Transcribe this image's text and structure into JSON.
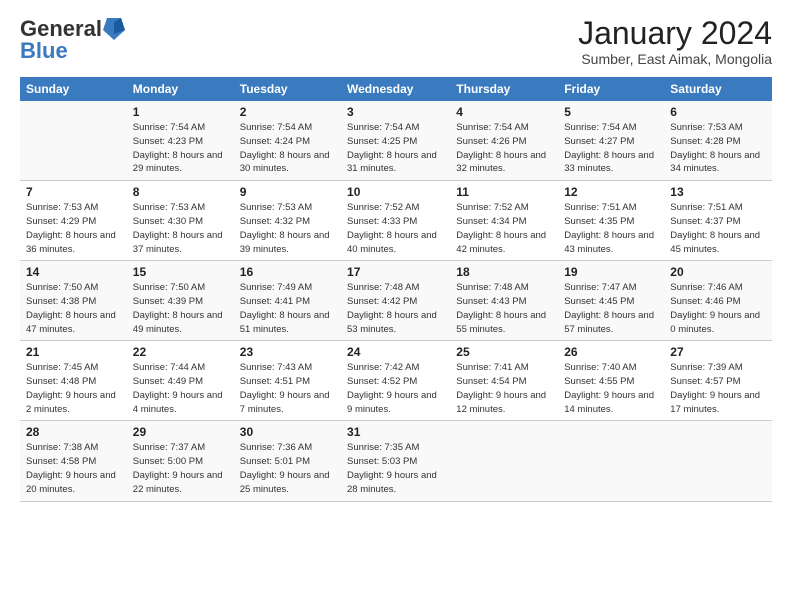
{
  "logo": {
    "general": "General",
    "blue": "Blue"
  },
  "header": {
    "title": "January 2024",
    "subtitle": "Sumber, East Aimak, Mongolia"
  },
  "weekdays": [
    "Sunday",
    "Monday",
    "Tuesday",
    "Wednesday",
    "Thursday",
    "Friday",
    "Saturday"
  ],
  "weeks": [
    [
      {
        "day": "",
        "sunrise": "",
        "sunset": "",
        "daylight": ""
      },
      {
        "day": "1",
        "sunrise": "Sunrise: 7:54 AM",
        "sunset": "Sunset: 4:23 PM",
        "daylight": "Daylight: 8 hours and 29 minutes."
      },
      {
        "day": "2",
        "sunrise": "Sunrise: 7:54 AM",
        "sunset": "Sunset: 4:24 PM",
        "daylight": "Daylight: 8 hours and 30 minutes."
      },
      {
        "day": "3",
        "sunrise": "Sunrise: 7:54 AM",
        "sunset": "Sunset: 4:25 PM",
        "daylight": "Daylight: 8 hours and 31 minutes."
      },
      {
        "day": "4",
        "sunrise": "Sunrise: 7:54 AM",
        "sunset": "Sunset: 4:26 PM",
        "daylight": "Daylight: 8 hours and 32 minutes."
      },
      {
        "day": "5",
        "sunrise": "Sunrise: 7:54 AM",
        "sunset": "Sunset: 4:27 PM",
        "daylight": "Daylight: 8 hours and 33 minutes."
      },
      {
        "day": "6",
        "sunrise": "Sunrise: 7:53 AM",
        "sunset": "Sunset: 4:28 PM",
        "daylight": "Daylight: 8 hours and 34 minutes."
      }
    ],
    [
      {
        "day": "7",
        "sunrise": "Sunrise: 7:53 AM",
        "sunset": "Sunset: 4:29 PM",
        "daylight": "Daylight: 8 hours and 36 minutes."
      },
      {
        "day": "8",
        "sunrise": "Sunrise: 7:53 AM",
        "sunset": "Sunset: 4:30 PM",
        "daylight": "Daylight: 8 hours and 37 minutes."
      },
      {
        "day": "9",
        "sunrise": "Sunrise: 7:53 AM",
        "sunset": "Sunset: 4:32 PM",
        "daylight": "Daylight: 8 hours and 39 minutes."
      },
      {
        "day": "10",
        "sunrise": "Sunrise: 7:52 AM",
        "sunset": "Sunset: 4:33 PM",
        "daylight": "Daylight: 8 hours and 40 minutes."
      },
      {
        "day": "11",
        "sunrise": "Sunrise: 7:52 AM",
        "sunset": "Sunset: 4:34 PM",
        "daylight": "Daylight: 8 hours and 42 minutes."
      },
      {
        "day": "12",
        "sunrise": "Sunrise: 7:51 AM",
        "sunset": "Sunset: 4:35 PM",
        "daylight": "Daylight: 8 hours and 43 minutes."
      },
      {
        "day": "13",
        "sunrise": "Sunrise: 7:51 AM",
        "sunset": "Sunset: 4:37 PM",
        "daylight": "Daylight: 8 hours and 45 minutes."
      }
    ],
    [
      {
        "day": "14",
        "sunrise": "Sunrise: 7:50 AM",
        "sunset": "Sunset: 4:38 PM",
        "daylight": "Daylight: 8 hours and 47 minutes."
      },
      {
        "day": "15",
        "sunrise": "Sunrise: 7:50 AM",
        "sunset": "Sunset: 4:39 PM",
        "daylight": "Daylight: 8 hours and 49 minutes."
      },
      {
        "day": "16",
        "sunrise": "Sunrise: 7:49 AM",
        "sunset": "Sunset: 4:41 PM",
        "daylight": "Daylight: 8 hours and 51 minutes."
      },
      {
        "day": "17",
        "sunrise": "Sunrise: 7:48 AM",
        "sunset": "Sunset: 4:42 PM",
        "daylight": "Daylight: 8 hours and 53 minutes."
      },
      {
        "day": "18",
        "sunrise": "Sunrise: 7:48 AM",
        "sunset": "Sunset: 4:43 PM",
        "daylight": "Daylight: 8 hours and 55 minutes."
      },
      {
        "day": "19",
        "sunrise": "Sunrise: 7:47 AM",
        "sunset": "Sunset: 4:45 PM",
        "daylight": "Daylight: 8 hours and 57 minutes."
      },
      {
        "day": "20",
        "sunrise": "Sunrise: 7:46 AM",
        "sunset": "Sunset: 4:46 PM",
        "daylight": "Daylight: 9 hours and 0 minutes."
      }
    ],
    [
      {
        "day": "21",
        "sunrise": "Sunrise: 7:45 AM",
        "sunset": "Sunset: 4:48 PM",
        "daylight": "Daylight: 9 hours and 2 minutes."
      },
      {
        "day": "22",
        "sunrise": "Sunrise: 7:44 AM",
        "sunset": "Sunset: 4:49 PM",
        "daylight": "Daylight: 9 hours and 4 minutes."
      },
      {
        "day": "23",
        "sunrise": "Sunrise: 7:43 AM",
        "sunset": "Sunset: 4:51 PM",
        "daylight": "Daylight: 9 hours and 7 minutes."
      },
      {
        "day": "24",
        "sunrise": "Sunrise: 7:42 AM",
        "sunset": "Sunset: 4:52 PM",
        "daylight": "Daylight: 9 hours and 9 minutes."
      },
      {
        "day": "25",
        "sunrise": "Sunrise: 7:41 AM",
        "sunset": "Sunset: 4:54 PM",
        "daylight": "Daylight: 9 hours and 12 minutes."
      },
      {
        "day": "26",
        "sunrise": "Sunrise: 7:40 AM",
        "sunset": "Sunset: 4:55 PM",
        "daylight": "Daylight: 9 hours and 14 minutes."
      },
      {
        "day": "27",
        "sunrise": "Sunrise: 7:39 AM",
        "sunset": "Sunset: 4:57 PM",
        "daylight": "Daylight: 9 hours and 17 minutes."
      }
    ],
    [
      {
        "day": "28",
        "sunrise": "Sunrise: 7:38 AM",
        "sunset": "Sunset: 4:58 PM",
        "daylight": "Daylight: 9 hours and 20 minutes."
      },
      {
        "day": "29",
        "sunrise": "Sunrise: 7:37 AM",
        "sunset": "Sunset: 5:00 PM",
        "daylight": "Daylight: 9 hours and 22 minutes."
      },
      {
        "day": "30",
        "sunrise": "Sunrise: 7:36 AM",
        "sunset": "Sunset: 5:01 PM",
        "daylight": "Daylight: 9 hours and 25 minutes."
      },
      {
        "day": "31",
        "sunrise": "Sunrise: 7:35 AM",
        "sunset": "Sunset: 5:03 PM",
        "daylight": "Daylight: 9 hours and 28 minutes."
      },
      {
        "day": "",
        "sunrise": "",
        "sunset": "",
        "daylight": ""
      },
      {
        "day": "",
        "sunrise": "",
        "sunset": "",
        "daylight": ""
      },
      {
        "day": "",
        "sunrise": "",
        "sunset": "",
        "daylight": ""
      }
    ]
  ]
}
